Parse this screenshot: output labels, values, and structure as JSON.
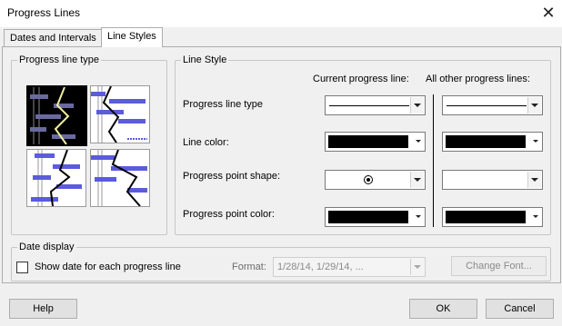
{
  "window": {
    "title": "Progress Lines"
  },
  "tabs": [
    {
      "label": "Dates and Intervals",
      "active": false
    },
    {
      "label": "Line Styles",
      "active": true
    }
  ],
  "progress_line_type_group": {
    "title": "Progress line type",
    "options": [
      {
        "name": "line-type-1",
        "selected": true
      },
      {
        "name": "line-type-2",
        "selected": false
      },
      {
        "name": "line-type-3",
        "selected": false
      },
      {
        "name": "line-type-4",
        "selected": false
      }
    ]
  },
  "line_style_group": {
    "title": "Line Style",
    "columns": {
      "current": "Current progress line:",
      "other": "All other progress lines:"
    },
    "rows": {
      "type": "Progress line type",
      "color": "Line color:",
      "shape": "Progress point shape:",
      "point_color": "Progress point color:"
    },
    "current": {
      "line_color": "#000000",
      "point_color": "#000000",
      "shape_symbol": "circle-with-dot"
    },
    "other": {
      "line_color": "#000000",
      "point_color": "#000000"
    }
  },
  "date_display": {
    "title": "Date display",
    "checkbox_label": "Show date for each progress line",
    "checked": false,
    "format_label": "Format:",
    "format_value": "1/28/14, 1/29/14, ...",
    "change_font_label": "Change Font..."
  },
  "buttons": {
    "help": "Help",
    "ok": "OK",
    "cancel": "Cancel"
  },
  "colors": {
    "bar_fill": "#5b5bdc",
    "selected_line": "#f0f0a0"
  }
}
